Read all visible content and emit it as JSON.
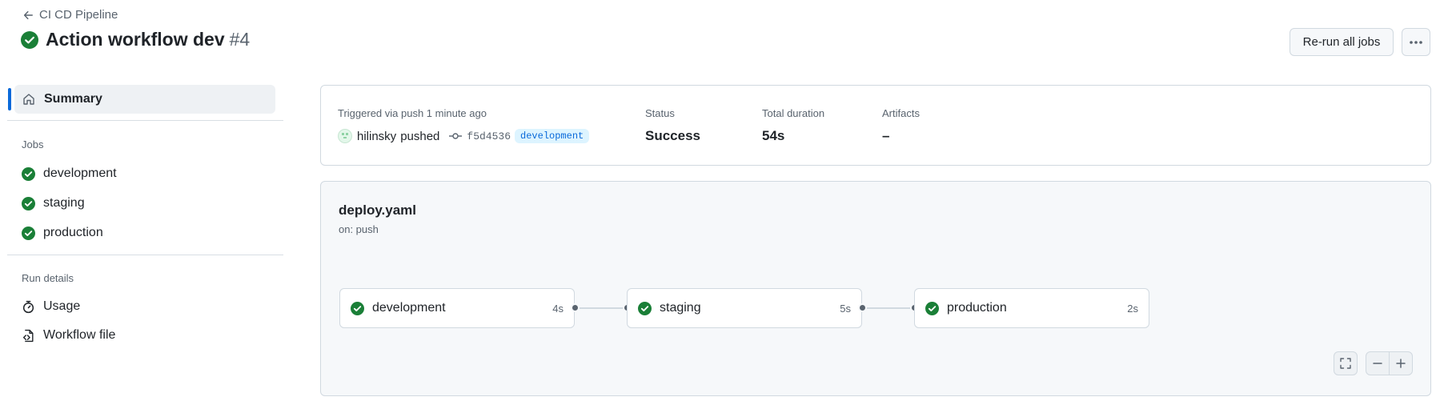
{
  "header": {
    "back_label": "CI CD Pipeline",
    "title": "Action workflow dev",
    "run_number": "#4",
    "rerun_label": "Re-run all jobs"
  },
  "sidebar": {
    "summary_label": "Summary",
    "jobs_heading": "Jobs",
    "jobs": [
      {
        "label": "development",
        "status": "success"
      },
      {
        "label": "staging",
        "status": "success"
      },
      {
        "label": "production",
        "status": "success"
      }
    ],
    "run_details_heading": "Run details",
    "details": [
      {
        "label": "Usage",
        "icon": "stopwatch-icon"
      },
      {
        "label": "Workflow file",
        "icon": "file-code-icon"
      }
    ]
  },
  "run_summary": {
    "trigger_text": "Triggered via push 1 minute ago",
    "actor": "hilinsky",
    "action": "pushed",
    "commit_sha": "f5d4536",
    "branch": "development",
    "status_label": "Status",
    "status_value": "Success",
    "duration_label": "Total duration",
    "duration_value": "54s",
    "artifacts_label": "Artifacts",
    "artifacts_value": "–"
  },
  "workflow": {
    "file": "deploy.yaml",
    "trigger": "on: push",
    "jobs": [
      {
        "name": "development",
        "duration": "4s"
      },
      {
        "name": "staging",
        "duration": "5s"
      },
      {
        "name": "production",
        "duration": "2s"
      }
    ]
  },
  "colors": {
    "success": "#1a7f37",
    "accent": "#0969da",
    "muted": "#59636e",
    "border": "#d1d9e0"
  }
}
